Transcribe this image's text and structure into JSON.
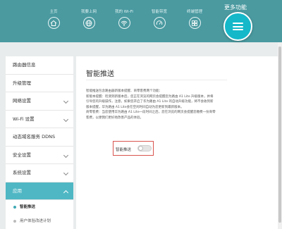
{
  "nav": {
    "items": [
      {
        "label": "主页",
        "icon": "home-icon"
      },
      {
        "label": "我要上网",
        "icon": "globe-icon"
      },
      {
        "label": "我的 Wi-Fi",
        "icon": "wifi-icon"
      },
      {
        "label": "智能带宽",
        "icon": "gauge-icon"
      },
      {
        "label": "终端管理",
        "icon": "grid-icon"
      }
    ],
    "more_label": "更多功能",
    "more_icon": "menu-icon"
  },
  "sidebar": {
    "items": [
      {
        "label": "路由器信息"
      },
      {
        "label": "升级管理"
      },
      {
        "label": "网络设置"
      },
      {
        "label": "Wi-Fi 设置"
      },
      {
        "label": "动态域名服务 DDNS"
      },
      {
        "label": "安全设置"
      },
      {
        "label": "系统设置"
      },
      {
        "label": "应用"
      }
    ],
    "subitems": [
      {
        "label": "智能推送"
      },
      {
        "label": "用户体验改进计划"
      }
    ]
  },
  "main": {
    "title": "智能推送",
    "description": [
      "智能推送包含路由器新版本提醒、商零客费两个功能：",
      "新版本提醒：检测到新版本后，您正在浏览的网页会提醒您为路由 A1 Lite 升级版本，并将引导您的升级操作，注意，如果您开启了华为路由 A1 Lite 的自动升级功能，将不会收到新版本提醒，华为路由 A1 Lite会在空闲时间自动为您更新到最新版本。",
      "商零客费：当您使用华为路由 A1 Lite一段时间之后，您在浏览的网页会提醒您缴费一份商零客费，以便我们更好地改善产品的体验。"
    ],
    "toggle_label": "智能推送",
    "toggle_on": false
  },
  "colors": {
    "header": "#4a9aa0",
    "accent": "#14b8c9",
    "active_menu": "#4fb7c4",
    "highlight_border": "#d9534f"
  }
}
